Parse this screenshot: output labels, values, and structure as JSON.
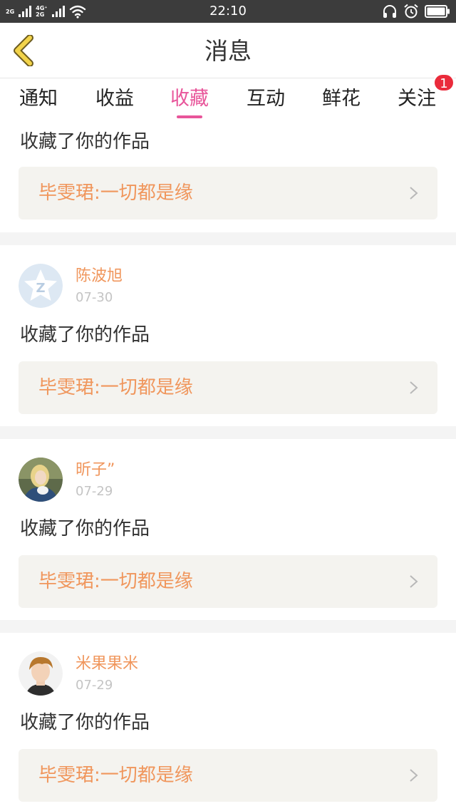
{
  "status_bar": {
    "net_top": "2G",
    "net_mid": "4G⁺",
    "net_bottom": "2G",
    "time": "22:10"
  },
  "header": {
    "title": "消息",
    "back_icon": "chevron-left-icon"
  },
  "tabs": [
    {
      "label": "通知",
      "active": false
    },
    {
      "label": "收益",
      "active": false
    },
    {
      "label": "收藏",
      "active": true
    },
    {
      "label": "互动",
      "active": false
    },
    {
      "label": "鲜花",
      "active": false
    },
    {
      "label": "关注",
      "active": false,
      "badge": "1"
    }
  ],
  "colors": {
    "accent": "#e8559a",
    "name_orange": "#f0965c",
    "badge_red": "#ea2b3b"
  },
  "messages": [
    {
      "action": "收藏了你的作品",
      "work": "毕雯珺:一切都是缘"
    },
    {
      "user": "陈波旭",
      "date": "07-30",
      "avatar": "default-star-avatar",
      "action": "收藏了你的作品",
      "work": "毕雯珺:一切都是缘"
    },
    {
      "user": "昕子”",
      "date": "07-29",
      "avatar": "photo-avatar",
      "action": "收藏了你的作品",
      "work": "毕雯珺:一切都是缘"
    },
    {
      "user": "米果果米",
      "date": "07-29",
      "avatar": "photo-avatar",
      "action": "收藏了你的作品",
      "work": "毕雯珺:一切都是缘"
    }
  ]
}
